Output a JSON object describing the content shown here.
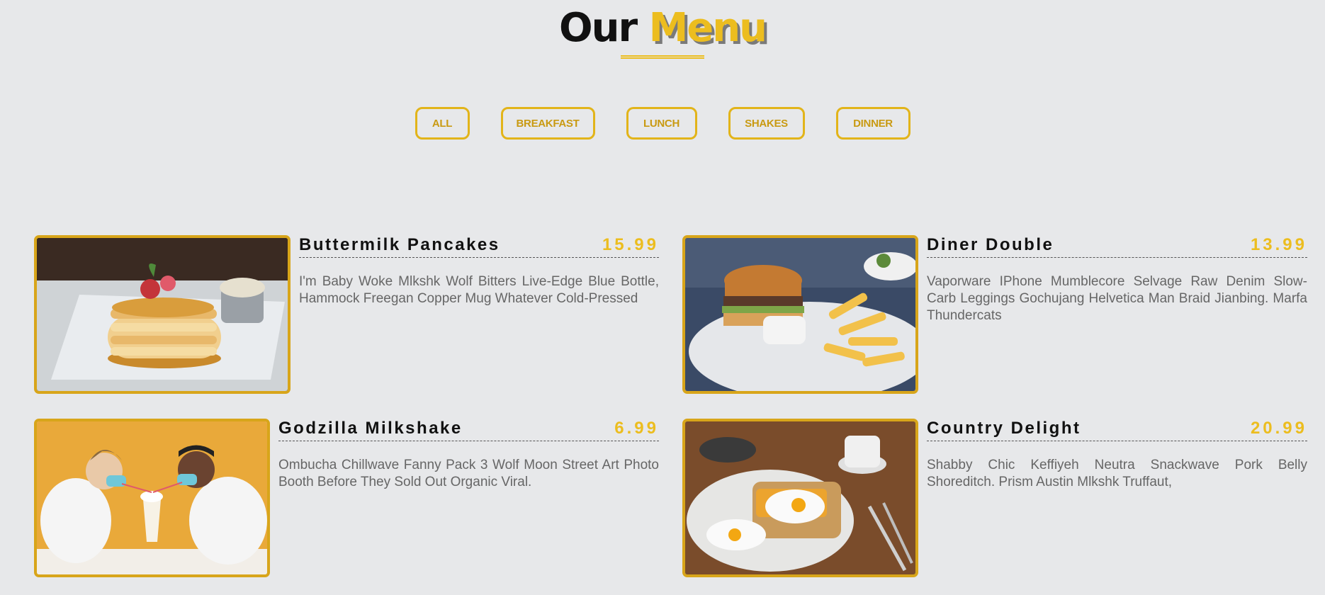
{
  "page": {
    "title_plain": "Our",
    "title_accent": "Menu"
  },
  "filters": [
    "ALL",
    "BREAKFAST",
    "LUNCH",
    "SHAKES",
    "DINNER"
  ],
  "colors": {
    "accent": "#ecbd1f",
    "background": "#e7e8ea",
    "border": "#d8a51a"
  },
  "items": [
    {
      "name": "Buttermilk Pancakes",
      "price": "15.99",
      "description": "I'm Baby Woke Mlkshk Wolf Bitters Live-Edge Blue Bottle, Hammock Freegan Copper Mug Whatever Cold-Pressed",
      "image": "pancakes-photo"
    },
    {
      "name": "Diner Double",
      "price": "13.99",
      "description": "Vaporware IPhone Mumblecore Selvage Raw Denim Slow-Carb Leggings Gochujang Helvetica Man Braid Jianbing. Marfa Thundercats",
      "image": "burger-photo"
    },
    {
      "name": "Godzilla Milkshake",
      "price": "6.99",
      "description": "Ombucha Chillwave Fanny Pack 3 Wolf Moon Street Art Photo Booth Before They Sold Out Organic Viral.",
      "image": "milkshake-photo"
    },
    {
      "name": "Country Delight",
      "price": "20.99",
      "description": "Shabby Chic Keffiyeh Neutra Snackwave Pork Belly Shoreditch. Prism Austin Mlkshk Truffaut,",
      "image": "breakfast-plate-photo"
    }
  ]
}
